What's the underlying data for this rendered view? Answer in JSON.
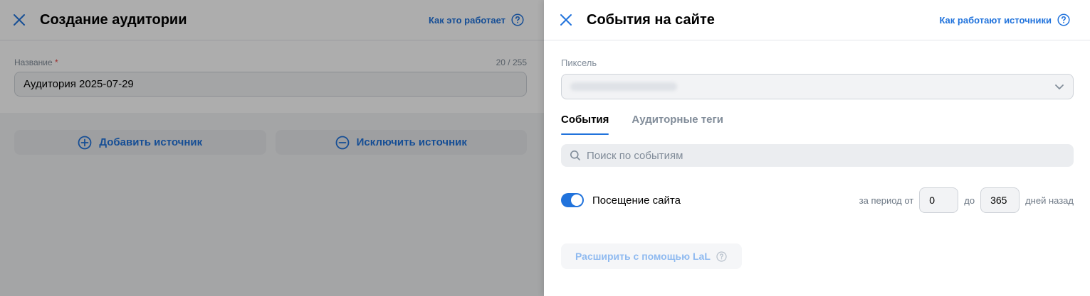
{
  "left": {
    "title": "Создание аудитории",
    "help_link": "Как это работает",
    "name_label": "Название",
    "name_required": "*",
    "name_counter": "20 / 255",
    "name_value": "Аудитория 2025-07-29",
    "add_source": "Добавить источник",
    "exclude_source": "Исключить источник"
  },
  "right": {
    "title": "События на сайте",
    "help_link": "Как работают источники",
    "pixel_label": "Пиксель",
    "tabs": [
      {
        "label": "События",
        "active": true
      },
      {
        "label": "Аудиторные теги",
        "active": false
      }
    ],
    "search_placeholder": "Поиск по событиям",
    "event": {
      "label": "Посещение сайта",
      "enabled": true,
      "period_from_label": "за период от",
      "from_value": "0",
      "to_label": "до",
      "to_value": "365",
      "suffix": "дней назад"
    },
    "lal_button": "Расширить с помощью LaL"
  },
  "colors": {
    "accent": "#2173dc",
    "muted_text": "#818c99",
    "disabled_accent": "#8fbaf0"
  },
  "icons": [
    "close-icon",
    "question-icon",
    "plus-circle-icon",
    "minus-circle-icon",
    "chevron-down-icon",
    "search-icon"
  ]
}
